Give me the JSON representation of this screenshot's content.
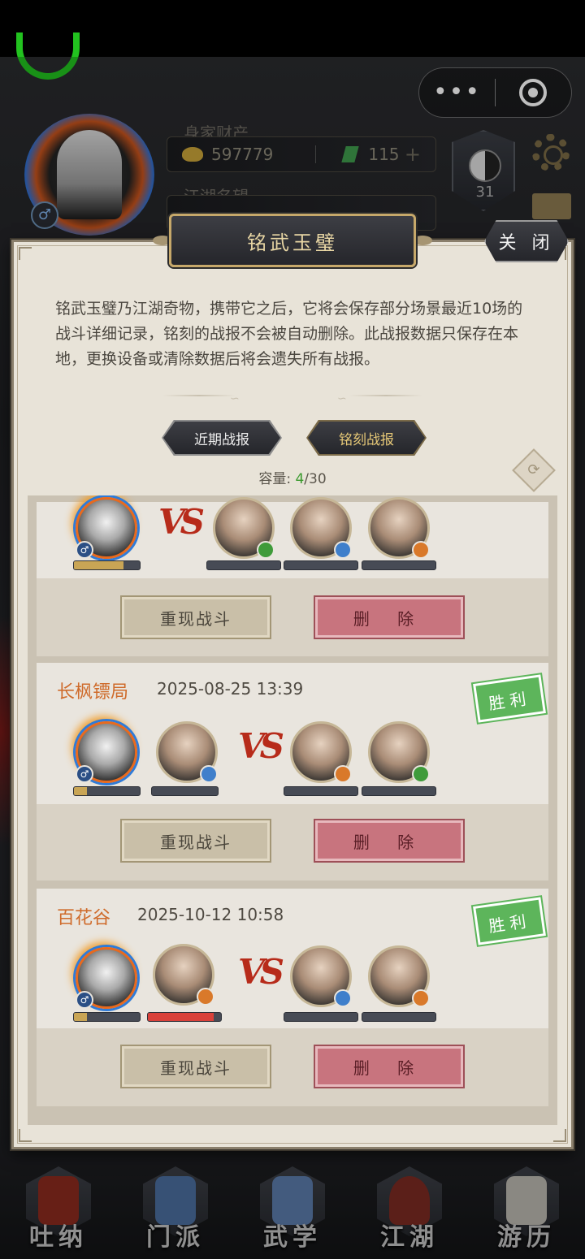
{
  "hud": {
    "wealth_label": "身家财产",
    "gold": "597779",
    "jade": "115",
    "fame_label": "江湖名望",
    "level": "31",
    "gender_icon": "♂"
  },
  "dialog": {
    "title": "铭武玉璧",
    "close_label": "关 闭",
    "description": "铭武玉璧乃江湖奇物，携带它之后，它将会保存部分场景最近10场的战斗详细记录，铭刻的战报不会被自动删除。此战报数据只保存在本地，更换设备或清除数据后将会遗失所有战报。",
    "tabs": [
      {
        "label": "近期战报",
        "active": false
      },
      {
        "label": "铭刻战报",
        "active": true
      }
    ],
    "capacity_label": "容量:",
    "capacity_used": "4",
    "capacity_total": "/30",
    "vs_text": "VS",
    "replay_label": "重现战斗",
    "delete_label": "删 除"
  },
  "records": [
    {
      "location": "",
      "time": "",
      "result": "",
      "allies": [
        {
          "hp": 0.75,
          "color": "#c9a555",
          "badge": "♂",
          "badge_color": "#2b4f85"
        }
      ],
      "enemies": [
        {
          "hp": 0.0,
          "badge": "",
          "badge_color": "#3f9b3a"
        },
        {
          "hp": 0.0,
          "badge": "",
          "badge_color": "#3f7fcb"
        },
        {
          "hp": 0.0,
          "badge": "",
          "badge_color": "#d9792a"
        }
      ]
    },
    {
      "location": "长枫镖局",
      "time": "2025-08-25 13:39",
      "result": "胜利",
      "allies": [
        {
          "hp": 0.2,
          "color": "#c9a555",
          "badge": "♂",
          "badge_color": "#2b4f85"
        },
        {
          "hp": 0.0,
          "color": "#c9a555",
          "badge": "",
          "badge_color": "#3f7fcb"
        }
      ],
      "enemies": [
        {
          "hp": 0.0,
          "badge": "",
          "badge_color": "#d9792a"
        },
        {
          "hp": 0.0,
          "badge": "",
          "badge_color": "#3f9b3a"
        }
      ]
    },
    {
      "location": "百花谷",
      "time": "2025-10-12 10:58",
      "result": "胜利",
      "allies": [
        {
          "hp": 0.2,
          "color": "#c9a555",
          "badge": "♂",
          "badge_color": "#2b4f85"
        },
        {
          "hp": 0.9,
          "color": "#d9413a",
          "badge": "",
          "badge_color": "#d9792a"
        }
      ],
      "enemies": [
        {
          "hp": 0.0,
          "badge": "",
          "badge_color": "#3f7fcb"
        },
        {
          "hp": 0.0,
          "badge": "",
          "badge_color": "#d9792a"
        }
      ]
    }
  ],
  "bottom_nav": [
    {
      "label": "吐纳",
      "icon": "meditation-icon"
    },
    {
      "label": "门派",
      "icon": "sect-icon"
    },
    {
      "label": "武学",
      "icon": "martial-arts-icon"
    },
    {
      "label": "江湖",
      "icon": "jianghu-icon"
    },
    {
      "label": "游历",
      "icon": "travel-icon"
    }
  ]
}
